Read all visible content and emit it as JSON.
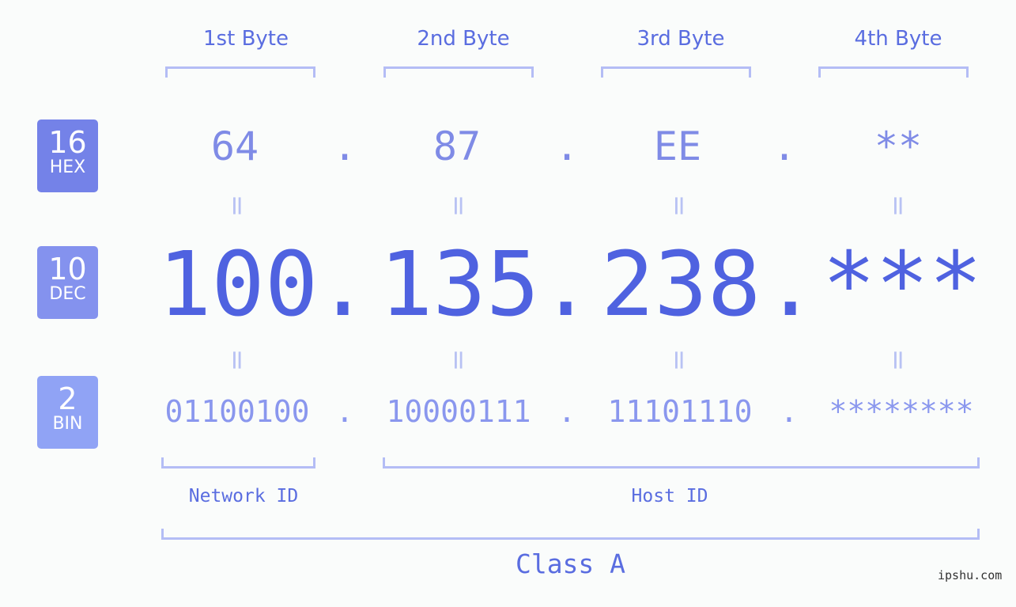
{
  "bytes": {
    "labels": [
      "1st Byte",
      "2nd Byte",
      "3rd Byte",
      "4th Byte"
    ]
  },
  "rows": {
    "hex": {
      "base": "16",
      "name": "HEX",
      "values": [
        "64",
        "87",
        "EE",
        "**"
      ],
      "color": "#7482e8"
    },
    "dec": {
      "base": "10",
      "name": "DEC",
      "values": [
        "100",
        "135",
        "238",
        "***"
      ],
      "color": "#8492ee"
    },
    "bin": {
      "base": "2",
      "name": "BIN",
      "values": [
        "01100100",
        "10000111",
        "11101110",
        "********"
      ],
      "color": "#90a3f5"
    }
  },
  "separator": ".",
  "equals": "=",
  "segments": {
    "network": "Network ID",
    "host": "Host ID"
  },
  "class_label": "Class A",
  "watermark": "ipshu.com"
}
